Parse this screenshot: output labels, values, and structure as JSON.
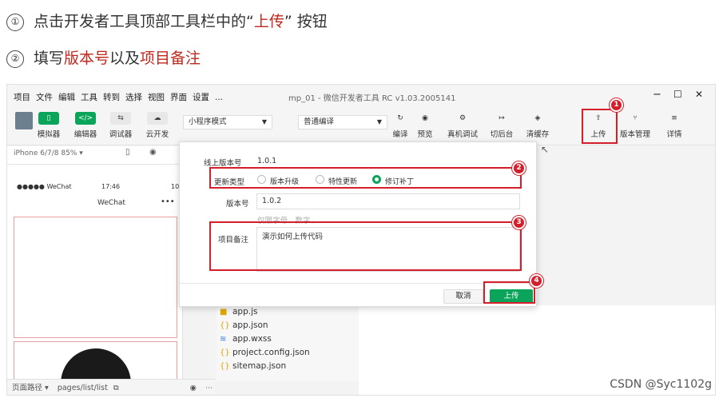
{
  "steps": [
    {
      "num": "①",
      "prefix": "点击开发者工具顶部工具栏中的“",
      "highlight": "上传",
      "suffix": "” 按钮"
    },
    {
      "num": "②",
      "prefix": "填写",
      "highlight": "版本号",
      "middle": "以及",
      "highlight2": "项目备注"
    }
  ],
  "menubar": {
    "items": [
      "项目",
      "文件",
      "编辑",
      "工具",
      "转到",
      "选择",
      "视图",
      "界面",
      "设置",
      "..."
    ],
    "title": "mp_01 - 微信开发者工具 RC v1.03.2005141",
    "minimize": "−",
    "maximize": "☐",
    "close": "✕"
  },
  "toolbar": {
    "simulator": "模拟器",
    "editor": "编辑器",
    "debugger": "调试器",
    "cloud": "云开发",
    "mode_select": "小程序模式",
    "compile_select": "普通编译",
    "compile": "编译",
    "preview": "预览",
    "real_debug": "真机调试",
    "background": "切后台",
    "clear_cache": "清缓存",
    "upload": "上传",
    "version_mgmt": "版本管理",
    "details": "详情"
  },
  "simulator": {
    "device": "iPhone 6/7/8 85% ▾",
    "carrier": "●●●●● WeChat",
    "time": "17:46",
    "battery": "100",
    "nav_title": "WeChat",
    "nav_dots": "•••"
  },
  "dialog": {
    "online_version_label": "线上版本号",
    "online_version": "1.0.1",
    "update_type_label": "更新类型",
    "options": [
      "版本升级",
      "特性更新",
      "修订补丁"
    ],
    "selected_option": "修订补丁",
    "version_label": "版本号",
    "version_value": "1.0.2",
    "version_hint": "仅限字母、数字、.",
    "notes_label": "项目备注",
    "notes_value": "演示如何上传代码",
    "cancel": "取消",
    "upload": "上传"
  },
  "annotations": [
    "1",
    "2",
    "3",
    "4"
  ],
  "files": [
    {
      "name": "app.js",
      "icon": "js-file-icon"
    },
    {
      "name": "app.json",
      "icon": "json-file-icon"
    },
    {
      "name": "app.wxss",
      "icon": "wxss-file-icon"
    },
    {
      "name": "project.config.json",
      "icon": "json-file-icon"
    },
    {
      "name": "sitemap.json",
      "icon": "json-file-icon"
    }
  ],
  "bottombar": {
    "page_path_label": "页面路径 ▾",
    "page_path": "pages/list/list"
  },
  "watermark": "CSDN @Syc1102g",
  "colors": {
    "accent_green": "#0aa55a",
    "annotation_red": "#d41f2b",
    "highlight_text": "#c0281e"
  }
}
